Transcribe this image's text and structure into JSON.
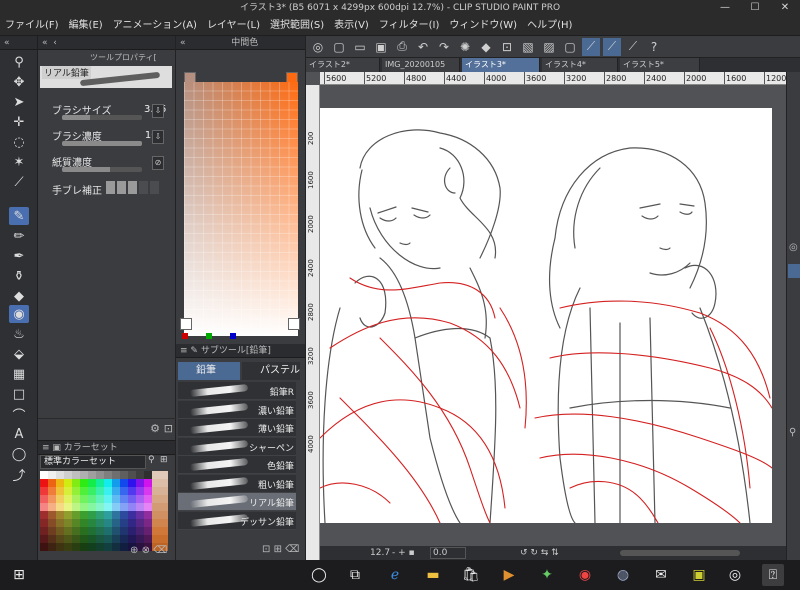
{
  "window": {
    "title": "イラスト3* (B5 6071 x 4299px 600dpi 12.7%)  - CLIP STUDIO PAINT PRO",
    "controls": {
      "minimize": "—",
      "maximize": "☐",
      "close": "✕"
    }
  },
  "menu": [
    "ファイル(F)",
    "編集(E)",
    "アニメーション(A)",
    "レイヤー(L)",
    "選択範囲(S)",
    "表示(V)",
    "フィルター(I)",
    "ウィンドウ(W)",
    "ヘルプ(H)"
  ],
  "tool_property": {
    "tab_label": "ツールプロパティ[",
    "brush_name": "リアル鉛筆",
    "rows": [
      {
        "label": "ブラシサイズ",
        "value": "3.46",
        "level": 0.35
      },
      {
        "label": "ブラシ濃度",
        "value": "100",
        "level": 1.0
      },
      {
        "label": "紙質濃度",
        "value": "60",
        "level": 0.6
      }
    ],
    "stabilization_label": "手ブレ補正",
    "stabilization_level": 3
  },
  "color_set": {
    "tab_label": "カラーセット",
    "set_name": "標準カラーセット"
  },
  "color_panel": {
    "tab_label": "中間色",
    "main_color": "#ff6a10",
    "sub_color": "#b59080"
  },
  "sub_tool": {
    "tab_label": "サブツール[鉛筆]",
    "groups": [
      "鉛筆",
      "パステル"
    ],
    "brushes": [
      {
        "name": "鉛筆R",
        "selected": false
      },
      {
        "name": "濃い鉛筆",
        "selected": false
      },
      {
        "name": "薄い鉛筆",
        "selected": false
      },
      {
        "name": "シャーペン",
        "selected": false
      },
      {
        "name": "色鉛筆",
        "selected": false
      },
      {
        "name": "粗い鉛筆",
        "selected": false
      },
      {
        "name": "リアル鉛筆",
        "selected": true
      },
      {
        "name": "デッサン鉛筆",
        "selected": false
      }
    ]
  },
  "doc_tabs": [
    {
      "label": "イラスト2*",
      "active": false
    },
    {
      "label": "IMG_20200105",
      "active": false
    },
    {
      "label": "イラスト3*",
      "active": true
    },
    {
      "label": "イラスト4*",
      "active": false
    },
    {
      "label": "イラスト5*",
      "active": false
    }
  ],
  "ruler": {
    "h_ticks": [
      "5600",
      "5200",
      "4800",
      "4400",
      "4000",
      "3600",
      "3200",
      "2800",
      "2400",
      "2000",
      "1600",
      "1200"
    ],
    "v_ticks": [
      "200",
      "1600",
      "2000",
      "2400",
      "2800",
      "3200",
      "3600",
      "4000"
    ]
  },
  "canvas_nav": {
    "zoom": "12.7",
    "rotation": "0.0"
  },
  "taskbar": {
    "icons": [
      "windows-icon",
      "cortana-icon",
      "task-view-icon",
      "edge-icon",
      "explorer-icon",
      "store-icon",
      "media-icon",
      "app-icon",
      "chrome-icon",
      "app2-icon",
      "mail-icon",
      "app3-icon",
      "clipstudio-icon",
      "clipstudio-paint-icon"
    ]
  }
}
